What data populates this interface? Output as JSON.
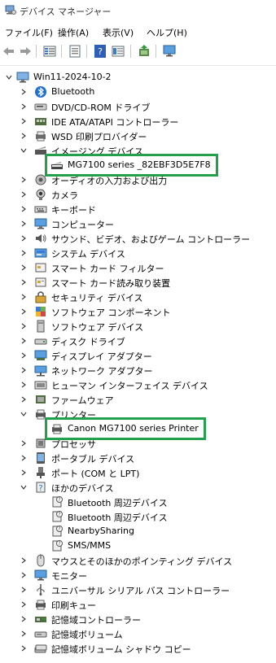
{
  "window": {
    "title": "デバイス マネージャー"
  },
  "menu": [
    "ファイル(F)",
    "操作(A)",
    "表示(V)",
    "ヘルプ(H)"
  ],
  "toolbar": [
    "back-icon",
    "forward-icon",
    "properties-grid-icon",
    "show-icon",
    "help-icon",
    "view-icon",
    "update-driver-icon",
    "monitor-icon"
  ],
  "tree": {
    "root": "Win11-2024-10-2",
    "items": [
      {
        "label": "Bluetooth",
        "icon": "bluetooth-icon",
        "expanded": false
      },
      {
        "label": "DVD/CD-ROM ドライブ",
        "icon": "dvd-drive-icon",
        "expanded": false
      },
      {
        "label": "IDE ATA/ATAPI コントローラー",
        "icon": "ide-controller-icon",
        "expanded": false
      },
      {
        "label": "WSD 印刷プロバイダー",
        "icon": "wsd-printer-icon",
        "expanded": false
      },
      {
        "label": "イメージング デバイス",
        "icon": "imaging-device-icon",
        "expanded": true,
        "children": [
          {
            "label": "MG7100 series _82EBF3D5E7F8",
            "icon": "scanner-icon",
            "highlighted": true
          }
        ]
      },
      {
        "label": "オーディオの入力および出力",
        "icon": "speaker-icon",
        "expanded": false
      },
      {
        "label": "カメラ",
        "icon": "camera-icon",
        "expanded": false
      },
      {
        "label": "キーボード",
        "icon": "keyboard-icon",
        "expanded": false
      },
      {
        "label": "コンピューター",
        "icon": "computer-icon",
        "expanded": false
      },
      {
        "label": "サウンド、ビデオ、およびゲーム コントローラー",
        "icon": "sound-icon",
        "expanded": false
      },
      {
        "label": "システム デバイス",
        "icon": "system-device-icon",
        "expanded": false
      },
      {
        "label": "スマート カード フィルター",
        "icon": "smart-card-filter-icon",
        "expanded": false
      },
      {
        "label": "スマート カード読み取り装置",
        "icon": "smart-card-reader-icon",
        "expanded": false
      },
      {
        "label": "セキュリティ デバイス",
        "icon": "security-device-icon",
        "expanded": false
      },
      {
        "label": "ソフトウェア コンポーネント",
        "icon": "software-component-icon",
        "expanded": false
      },
      {
        "label": "ソフトウェア デバイス",
        "icon": "software-device-icon",
        "expanded": false
      },
      {
        "label": "ディスク ドライブ",
        "icon": "disk-drive-icon",
        "expanded": false
      },
      {
        "label": "ディスプレイ アダプター",
        "icon": "display-adapter-icon",
        "expanded": false
      },
      {
        "label": "ネットワーク アダプター",
        "icon": "network-adapter-icon",
        "expanded": false
      },
      {
        "label": "ヒューマン インターフェイス デバイス",
        "icon": "hid-icon",
        "expanded": false
      },
      {
        "label": "ファームウェア",
        "icon": "firmware-icon",
        "expanded": false
      },
      {
        "label": "プリンター",
        "icon": "printer-category-icon",
        "expanded": true,
        "children": [
          {
            "label": "Canon MG7100 series Printer",
            "icon": "printer-icon",
            "highlighted": true
          }
        ]
      },
      {
        "label": "プロセッサ",
        "icon": "processor-icon",
        "expanded": false
      },
      {
        "label": "ポータブル デバイス",
        "icon": "portable-device-icon",
        "expanded": false
      },
      {
        "label": "ポート (COM と LPT)",
        "icon": "port-icon",
        "expanded": false
      },
      {
        "label": "ほかのデバイス",
        "icon": "other-devices-icon",
        "expanded": true,
        "children": [
          {
            "label": "Bluetooth 周辺デバイス",
            "icon": "unknown-device-icon"
          },
          {
            "label": "Bluetooth 周辺デバイス",
            "icon": "unknown-device-icon"
          },
          {
            "label": "NearbySharing",
            "icon": "unknown-device-icon"
          },
          {
            "label": "SMS/MMS",
            "icon": "unknown-device-icon"
          }
        ]
      },
      {
        "label": "マウスとそのほかのポインティング デバイス",
        "icon": "mouse-icon",
        "expanded": false
      },
      {
        "label": "モニター",
        "icon": "monitor-icon",
        "expanded": false
      },
      {
        "label": "ユニバーサル シリアル バス コントローラー",
        "icon": "usb-icon",
        "expanded": false
      },
      {
        "label": "印刷キュー",
        "icon": "print-queue-icon",
        "expanded": false
      },
      {
        "label": "記憶域コントローラー",
        "icon": "storage-controller-icon",
        "expanded": false
      },
      {
        "label": "記憶域ボリューム",
        "icon": "storage-volume-icon",
        "expanded": false
      },
      {
        "label": "記憶域ボリューム シャドウ コピー",
        "icon": "shadow-copy-icon",
        "expanded": false
      }
    ]
  },
  "colors": {
    "highlight_border": "#22a04b",
    "accent": "#1e6fd9"
  }
}
